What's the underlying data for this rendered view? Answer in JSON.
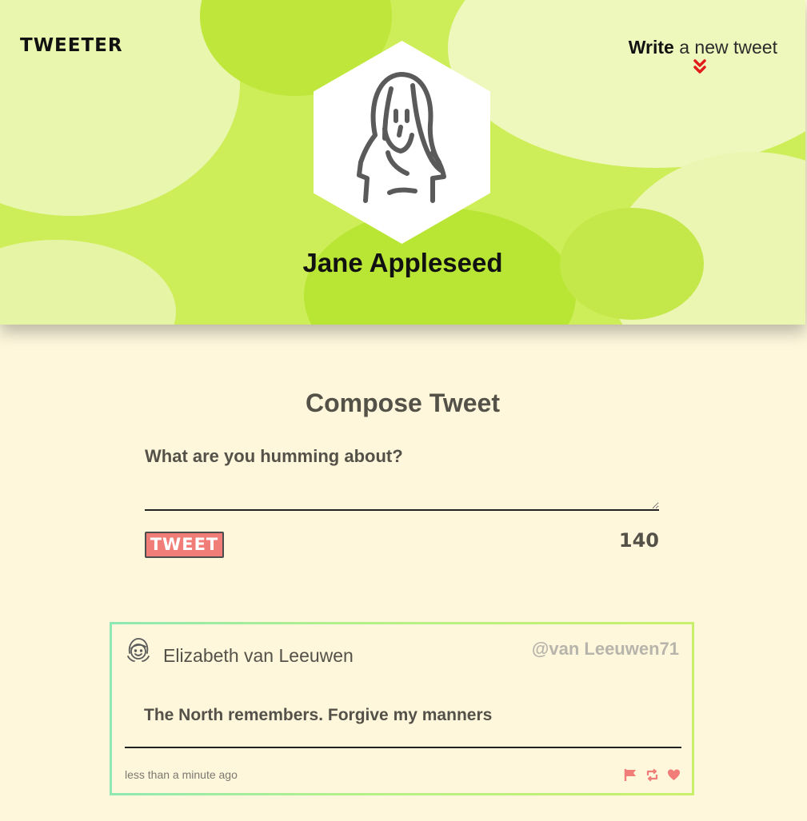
{
  "header": {
    "brand": "TWEETER",
    "write_bold": "Write",
    "write_rest": " a new tweet",
    "profile_name": "Jane Appleseed"
  },
  "compose": {
    "title": "Compose Tweet",
    "label": "What are you humming about?",
    "textarea_value": "",
    "button_label": "TWEET",
    "char_counter": "140"
  },
  "tweet": {
    "author": "Elizabeth van Leeuwen",
    "handle": "@van Leeuwen71",
    "body": "The North remembers. Forgive my manners",
    "timestamp": "less than a minute ago",
    "actions": [
      "flag-icon",
      "retweet-icon",
      "heart-icon"
    ]
  },
  "colors": {
    "header_green": "#cdee58",
    "page_bg": "#fef7dc",
    "accent_coral": "#f07d78",
    "chevron_red": "#e21b1b",
    "text_dark": "#545149"
  }
}
